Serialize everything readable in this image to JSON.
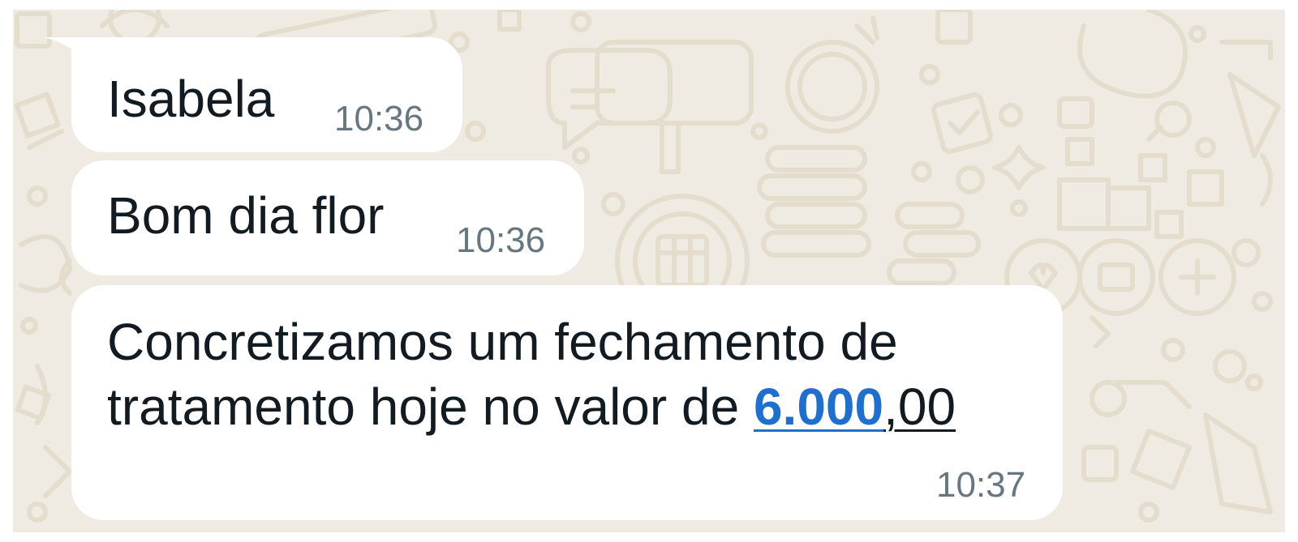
{
  "chat": {
    "messages": [
      {
        "text": "Isabela",
        "time": "10:36"
      },
      {
        "text": "Bom dia flor",
        "time": "10:36"
      },
      {
        "line1": "Concretizamos um fechamento de",
        "line2_prefix": "tratamento hoje no valor de ",
        "amount_link": "6.000",
        "amount_suffix": ",00",
        "time": "10:37"
      }
    ]
  },
  "colors": {
    "wallpaper": "#efeae2",
    "bubble": "#ffffff",
    "timestamp": "#667781",
    "link": "#1f6fd1"
  }
}
